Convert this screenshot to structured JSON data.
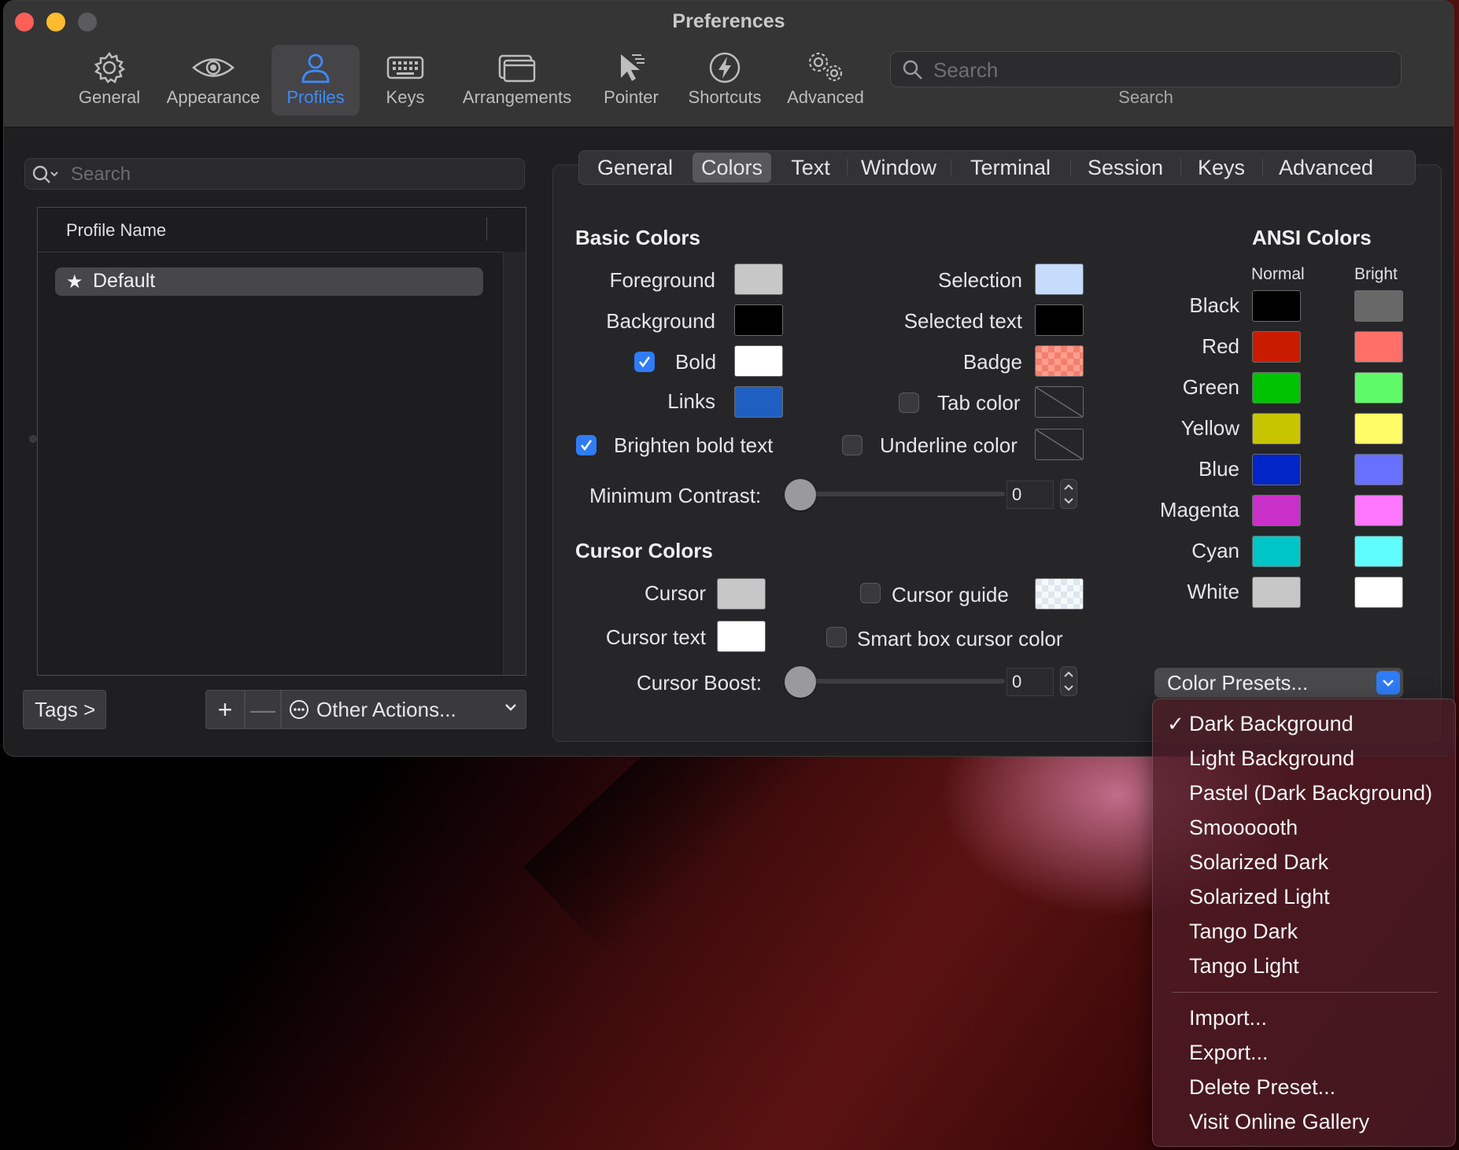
{
  "window": {
    "title": "Preferences"
  },
  "toolbar": {
    "items": [
      {
        "label": "General",
        "icon": "gear-icon"
      },
      {
        "label": "Appearance",
        "icon": "eye-icon"
      },
      {
        "label": "Profiles",
        "icon": "person-icon",
        "active": true
      },
      {
        "label": "Keys",
        "icon": "keyboard-icon"
      },
      {
        "label": "Arrangements",
        "icon": "windows-icon"
      },
      {
        "label": "Pointer",
        "icon": "cursor-icon"
      },
      {
        "label": "Shortcuts",
        "icon": "bolt-icon"
      },
      {
        "label": "Advanced",
        "icon": "gears-icon"
      }
    ],
    "search_placeholder": "Search",
    "search_label": "Search"
  },
  "profiles": {
    "search_placeholder": "Search",
    "column_header": "Profile Name",
    "rows": [
      {
        "name": "Default",
        "starred": true
      }
    ],
    "tags_button": "Tags >",
    "add_button": "+",
    "remove_button": "—",
    "other_actions": "Other Actions..."
  },
  "tabs": [
    "General",
    "Colors",
    "Text",
    "Window",
    "Terminal",
    "Session",
    "Keys",
    "Advanced"
  ],
  "active_tab": "Colors",
  "basic_colors": {
    "title": "Basic Colors",
    "foreground": {
      "label": "Foreground",
      "color": "#c7c7c7"
    },
    "background": {
      "label": "Background",
      "color": "#000000"
    },
    "bold": {
      "label": "Bold",
      "color": "#ffffff",
      "checked": true
    },
    "links": {
      "label": "Links",
      "color": "#1f5fc2"
    },
    "selection": {
      "label": "Selection",
      "color": "#c6dcfc"
    },
    "selected_text": {
      "label": "Selected text",
      "color": "#000000"
    },
    "badge": {
      "label": "Badge",
      "color": "#f07f6d"
    },
    "tab_color": {
      "label": "Tab color",
      "checked": false
    },
    "underline_color": {
      "label": "Underline color",
      "checked": false
    },
    "brighten_bold": {
      "label": "Brighten bold text",
      "checked": true
    },
    "min_contrast": {
      "label": "Minimum Contrast:",
      "value": "0"
    }
  },
  "cursor_colors": {
    "title": "Cursor Colors",
    "cursor": {
      "label": "Cursor",
      "color": "#c7c7c7"
    },
    "cursor_text": {
      "label": "Cursor text",
      "color": "#ffffff"
    },
    "cursor_guide": {
      "label": "Cursor guide",
      "checked": false
    },
    "smart_box": {
      "label": "Smart box cursor color",
      "checked": false
    },
    "cursor_boost": {
      "label": "Cursor Boost:",
      "value": "0"
    }
  },
  "ansi": {
    "title": "ANSI Colors",
    "normal_label": "Normal",
    "bright_label": "Bright",
    "rows": [
      {
        "name": "Black",
        "normal": "#000000",
        "bright": "#686868"
      },
      {
        "name": "Red",
        "normal": "#c91b00",
        "bright": "#ff6e67"
      },
      {
        "name": "Green",
        "normal": "#00c200",
        "bright": "#5ffa68"
      },
      {
        "name": "Yellow",
        "normal": "#c7c400",
        "bright": "#fffc67"
      },
      {
        "name": "Blue",
        "normal": "#0225c7",
        "bright": "#6871ff"
      },
      {
        "name": "Magenta",
        "normal": "#c930c7",
        "bright": "#ff77ff"
      },
      {
        "name": "Cyan",
        "normal": "#00c5c7",
        "bright": "#60fdff"
      },
      {
        "name": "White",
        "normal": "#c7c7c7",
        "bright": "#ffffff"
      }
    ]
  },
  "presets": {
    "button_label": "Color Presets...",
    "menu": [
      {
        "label": "Dark Background",
        "checked": true
      },
      {
        "label": "Light Background"
      },
      {
        "label": "Pastel (Dark Background)"
      },
      {
        "label": "Smoooooth"
      },
      {
        "label": "Solarized Dark"
      },
      {
        "label": "Solarized Light"
      },
      {
        "label": "Tango Dark"
      },
      {
        "label": "Tango Light"
      }
    ],
    "actions": [
      {
        "label": "Import..."
      },
      {
        "label": "Export..."
      },
      {
        "label": "Delete Preset..."
      },
      {
        "label": "Visit Online Gallery"
      }
    ]
  }
}
